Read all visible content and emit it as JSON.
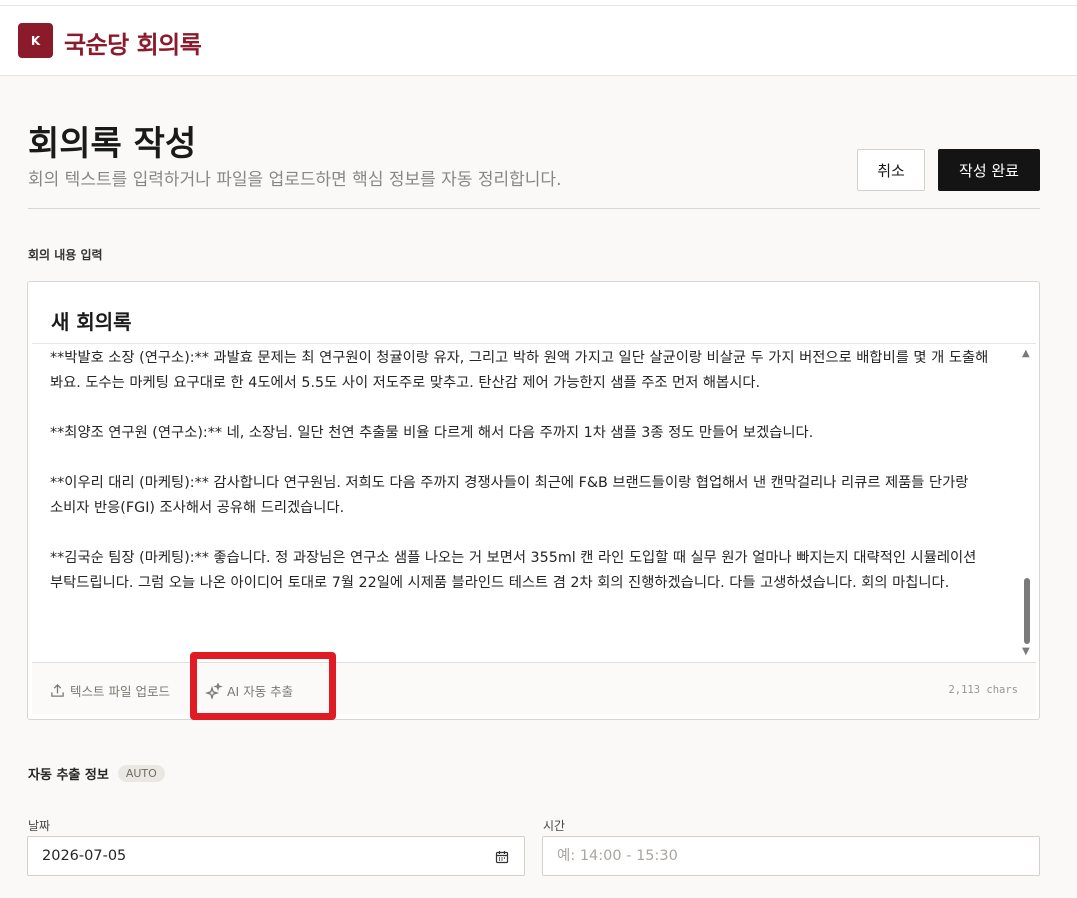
{
  "header": {
    "logo_letter": "K",
    "app_title": "국순당 회의록"
  },
  "page": {
    "title": "회의록 작성",
    "subtitle": "회의 텍스트를 입력하거나 파일을 업로드하면 핵심 정보를 자동 정리합니다.",
    "cancel_label": "취소",
    "submit_label": "작성 완료"
  },
  "input_section": {
    "label": "회의 내용 입력",
    "editor_title": "새 회의록",
    "paragraphs": [
      "**박발호 소장 (연구소):** 과발효 문제는 최 연구원이 청귤이랑 유자, 그리고 박하 원액 가지고 일단 살균이랑 비살균 두 가지 버전으로 배합비를 몇 개 도출해 봐요. 도수는 마케팅 요구대로 한 4도에서 5.5도 사이 저도주로 맞추고. 탄산감 제어 가능한지 샘플 주조 먼저 해봅시다.",
      "**최양조 연구원 (연구소):** 네, 소장님. 일단 천연 추출물 비율 다르게 해서 다음 주까지 1차 샘플 3종 정도 만들어 보겠습니다.",
      "**이우리 대리 (마케팅):** 감사합니다 연구원님. 저희도 다음 주까지 경쟁사들이 최근에 F&B 브랜드들이랑 협업해서 낸 캔막걸리나 리큐르 제품들 단가랑 소비자 반응(FGI) 조사해서 공유해 드리겠습니다.",
      "**김국순 팀장 (마케팅):** 좋습니다. 정 과장님은 연구소 샘플 나오는 거 보면서 355ml 캔 라인 도입할 때 실무 원가 얼마나 빠지는지 대략적인 시뮬레이션 부탁드립니다. 그럼 오늘 나온 아이디어 토대로 7월 22일에 시제품 블라인드 테스트 겸 2차 회의 진행하겠습니다. 다들 고생하셨습니다. 회의 마칩니다."
    ],
    "upload_label": "텍스트 파일 업로드",
    "ai_label": "AI 자동 추출",
    "char_count": "2,113 chars",
    "icons": {
      "upload": "upload-icon",
      "ai": "sparkle-icon"
    }
  },
  "auto_section": {
    "label": "자동 추출 정보",
    "badge": "AUTO",
    "date_label": "날짜",
    "date_value": "2026-07-05",
    "time_label": "시간",
    "time_placeholder": "예: 14:00 - 15:30"
  },
  "colors": {
    "brand": "#8b1a2b",
    "highlight": "#e01b24"
  }
}
